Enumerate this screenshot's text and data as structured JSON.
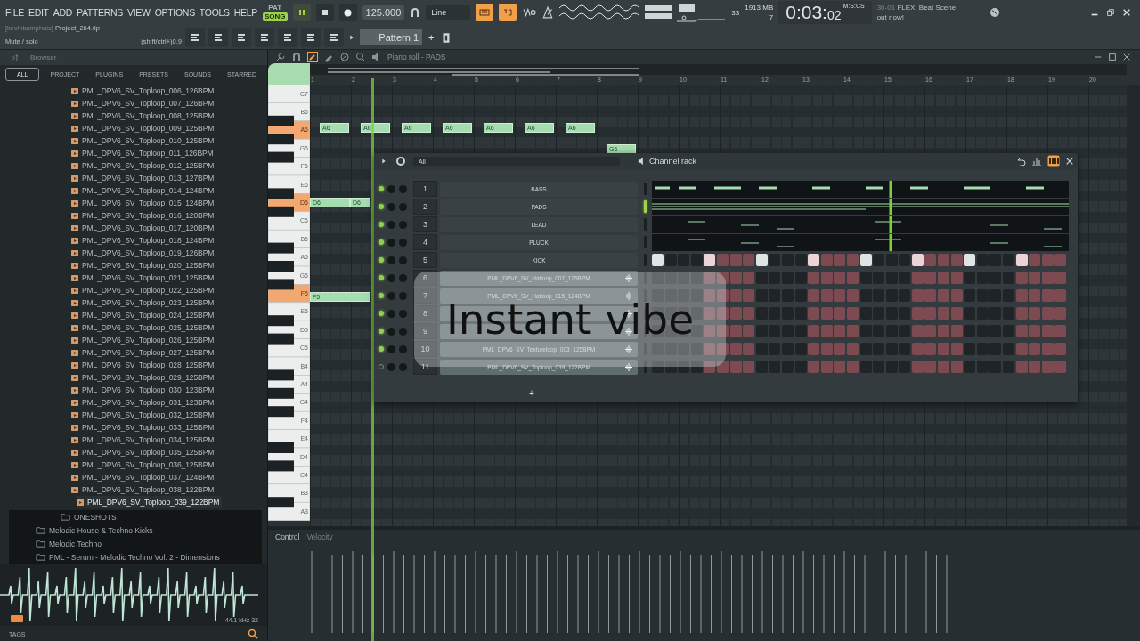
{
  "menu": [
    "FILE",
    "EDIT",
    "ADD",
    "PATTERNS",
    "VIEW",
    "OPTIONS",
    "TOOLS",
    "HELP"
  ],
  "transport": {
    "mode_pat": "PAT",
    "mode_song": "SONG",
    "song_selected": true,
    "playing": true,
    "tempo": "125.000",
    "snap": "Line"
  },
  "monitor": {
    "cpu": "33",
    "memory": "1913 MB",
    "polyphony": "7"
  },
  "time": {
    "value": "0:03:",
    "cs": "02",
    "format": "M:S:CS"
  },
  "news": {
    "date": "30-01",
    "title": "FLEX: Beat Scene",
    "subtitle": "out now!"
  },
  "project": {
    "user": "[kevinkamphuis]",
    "file": "Project_264.flp",
    "hint": "Mute / solo",
    "shortcut": "(shift/ctrl+)0.9"
  },
  "pattern": {
    "name": "Pattern 1",
    "add": "+"
  },
  "browser": {
    "title": "Browser",
    "tabs": [
      {
        "label": "ALL",
        "selected": true
      },
      {
        "label": "PROJECT",
        "selected": false
      },
      {
        "label": "PLUGINS",
        "selected": false
      },
      {
        "label": "PRESETS",
        "selected": false
      },
      {
        "label": "SOUNDS",
        "selected": false
      },
      {
        "label": "STARRED",
        "selected": false
      }
    ],
    "files": [
      {
        "name": "PML_DPV6_SV_Toploop_006_126BPM",
        "selected": false
      },
      {
        "name": "PML_DPV6_SV_Toploop_007_126BPM",
        "selected": false
      },
      {
        "name": "PML_DPV6_SV_Toploop_008_125BPM",
        "selected": false
      },
      {
        "name": "PML_DPV6_SV_Toploop_009_125BPM",
        "selected": false
      },
      {
        "name": "PML_DPV6_SV_Toploop_010_125BPM",
        "selected": false
      },
      {
        "name": "PML_DPV6_SV_Toploop_011_126BPM",
        "selected": false
      },
      {
        "name": "PML_DPV6_SV_Toploop_012_125BPM",
        "selected": false
      },
      {
        "name": "PML_DPV6_SV_Toploop_013_127BPM",
        "selected": false
      },
      {
        "name": "PML_DPV6_SV_Toploop_014_124BPM",
        "selected": false
      },
      {
        "name": "PML_DPV6_SV_Toploop_015_124BPM",
        "selected": false
      },
      {
        "name": "PML_DPV6_SV_Toploop_016_120BPM",
        "selected": false
      },
      {
        "name": "PML_DPV6_SV_Toploop_017_120BPM",
        "selected": false
      },
      {
        "name": "PML_DPV6_SV_Toploop_018_124BPM",
        "selected": false
      },
      {
        "name": "PML_DPV6_SV_Toploop_019_126BPM",
        "selected": false
      },
      {
        "name": "PML_DPV6_SV_Toploop_020_125BPM",
        "selected": false
      },
      {
        "name": "PML_DPV6_SV_Toploop_021_125BPM",
        "selected": false
      },
      {
        "name": "PML_DPV6_SV_Toploop_022_125BPM",
        "selected": false
      },
      {
        "name": "PML_DPV6_SV_Toploop_023_125BPM",
        "selected": false
      },
      {
        "name": "PML_DPV6_SV_Toploop_024_125BPM",
        "selected": false
      },
      {
        "name": "PML_DPV6_SV_Toploop_025_125BPM",
        "selected": false
      },
      {
        "name": "PML_DPV6_SV_Toploop_026_125BPM",
        "selected": false
      },
      {
        "name": "PML_DPV6_SV_Toploop_027_125BPM",
        "selected": false
      },
      {
        "name": "PML_DPV6_SV_Toploop_028_125BPM",
        "selected": false
      },
      {
        "name": "PML_DPV6_SV_Toploop_029_125BPM",
        "selected": false
      },
      {
        "name": "PML_DPV6_SV_Toploop_030_123BPM",
        "selected": false
      },
      {
        "name": "PML_DPV6_SV_Toploop_031_123BPM",
        "selected": false
      },
      {
        "name": "PML_DPV6_SV_Toploop_032_125BPM",
        "selected": false
      },
      {
        "name": "PML_DPV6_SV_Toploop_033_125BPM",
        "selected": false
      },
      {
        "name": "PML_DPV6_SV_Toploop_034_125BPM",
        "selected": false
      },
      {
        "name": "PML_DPV6_SV_Toploop_035_125BPM",
        "selected": false
      },
      {
        "name": "PML_DPV6_SV_Toploop_036_125BPM",
        "selected": false
      },
      {
        "name": "PML_DPV6_SV_Toploop_037_124BPM",
        "selected": false
      },
      {
        "name": "PML_DPV6_SV_Toploop_038_122BPM",
        "selected": false
      },
      {
        "name": "PML_DPV6_SV_Toploop_039_122BPM",
        "selected": true
      }
    ],
    "subfolders": [
      {
        "name": "ONESHOTS"
      }
    ],
    "folders": [
      {
        "name": "Melodic House & Techno Kicks"
      },
      {
        "name": "Melodic Techno"
      },
      {
        "name": "PML - Serum - Melodic Techno Vol. 2 - Dimensions"
      }
    ],
    "preview": {
      "info": "44.1 kHz 32"
    },
    "tags": "TAGS"
  },
  "piano_roll": {
    "title": "Piano roll - PADS",
    "bars": [
      "1",
      "2",
      "3",
      "4",
      "5",
      "6",
      "7",
      "8",
      "9",
      "10",
      "11",
      "12",
      "13",
      "14",
      "15",
      "16",
      "17",
      "18",
      "19",
      "20"
    ],
    "keys": [
      {
        "label": "C7",
        "highlighted": false
      },
      {
        "label": "B6",
        "highlighted": false
      },
      {
        "label": "A6",
        "highlighted": true
      },
      {
        "label": "G6",
        "highlighted": false
      },
      {
        "label": "F6",
        "highlighted": false
      },
      {
        "label": "E6",
        "highlighted": false
      },
      {
        "label": "D6",
        "highlighted": true
      },
      {
        "label": "C6",
        "highlighted": false
      },
      {
        "label": "B5",
        "highlighted": false
      },
      {
        "label": "A5",
        "highlighted": false
      },
      {
        "label": "G5",
        "highlighted": false
      },
      {
        "label": "F5",
        "highlighted": true
      },
      {
        "label": "E5",
        "highlighted": false
      },
      {
        "label": "D5",
        "highlighted": false
      },
      {
        "label": "C5",
        "highlighted": false
      },
      {
        "label": "B4",
        "highlighted": false
      },
      {
        "label": "A4",
        "highlighted": false
      },
      {
        "label": "G4",
        "highlighted": false
      },
      {
        "label": "F4",
        "highlighted": false
      },
      {
        "label": "E4",
        "highlighted": false
      },
      {
        "label": "D4",
        "highlighted": false
      },
      {
        "label": "C4",
        "highlighted": false
      },
      {
        "label": "B3",
        "highlighted": false
      },
      {
        "label": "A3",
        "highlighted": false
      }
    ],
    "notes": [
      {
        "label": "A6"
      },
      {
        "label": "A6"
      },
      {
        "label": "A6"
      },
      {
        "label": "A6"
      },
      {
        "label": "A6"
      },
      {
        "label": "A6"
      },
      {
        "label": "A6"
      },
      {
        "label": "G6"
      },
      {
        "label": "D6"
      },
      {
        "label": "D6"
      },
      {
        "label": "F5"
      }
    ],
    "control": "Control",
    "velocity": "Velocity"
  },
  "channel_rack": {
    "filter": "All",
    "title": "Channel rack",
    "add": "+",
    "channels": [
      {
        "number": "1",
        "name": "BASS",
        "kind": "roll",
        "enabled": true,
        "selected": false
      },
      {
        "number": "2",
        "name": "PADS",
        "kind": "roll",
        "enabled": true,
        "selected": true
      },
      {
        "number": "3",
        "name": "LEAD",
        "kind": "roll",
        "enabled": true,
        "selected": false
      },
      {
        "number": "4",
        "name": "PLUCK",
        "kind": "roll",
        "enabled": true,
        "selected": false
      },
      {
        "number": "5",
        "name": "KICK",
        "kind": "steps",
        "enabled": true,
        "selected": false,
        "steps": [
          true,
          false,
          false,
          false,
          true,
          false,
          false,
          false,
          true,
          false,
          false,
          false,
          true,
          false,
          false,
          false,
          true,
          false,
          false,
          false,
          true,
          false,
          false,
          false,
          true,
          false,
          false,
          false,
          true,
          false,
          false,
          false
        ]
      },
      {
        "number": "6",
        "name": "PML_DPV6_SV_Hatloop_007_125BPM",
        "kind": "sample",
        "enabled": true,
        "selected": false,
        "steps": [
          false,
          false,
          false,
          false,
          false,
          false,
          false,
          false,
          false,
          false,
          false,
          false,
          false,
          false,
          false,
          false,
          false,
          false,
          false,
          false,
          false,
          false,
          false,
          false,
          false,
          false,
          false,
          false,
          false,
          false,
          false,
          false
        ]
      },
      {
        "number": "7",
        "name": "PML_DPV6_SV_Hatloop_015_124BPM",
        "kind": "sample",
        "enabled": true,
        "selected": false,
        "steps": [
          false,
          false,
          false,
          false,
          false,
          false,
          false,
          false,
          false,
          false,
          false,
          false,
          false,
          false,
          false,
          false,
          false,
          false,
          false,
          false,
          false,
          false,
          false,
          false,
          false,
          false,
          false,
          false,
          false,
          false,
          false,
          false
        ]
      },
      {
        "number": "8",
        "kind": "sample",
        "enabled": true,
        "selected": false,
        "steps": [
          false,
          false,
          false,
          false,
          false,
          false,
          false,
          false,
          false,
          false,
          false,
          false,
          false,
          false,
          false,
          false,
          false,
          false,
          false,
          false,
          false,
          false,
          false,
          false,
          false,
          false,
          false,
          false,
          false,
          false,
          false,
          false
        ]
      },
      {
        "number": "9",
        "kind": "sample",
        "enabled": true,
        "selected": false,
        "steps": [
          false,
          false,
          false,
          false,
          false,
          false,
          false,
          false,
          false,
          false,
          false,
          false,
          false,
          false,
          false,
          false,
          false,
          false,
          false,
          false,
          false,
          false,
          false,
          false,
          false,
          false,
          false,
          false,
          false,
          false,
          false,
          false
        ]
      },
      {
        "number": "10",
        "name": "PML_DPV6_SV_Textureloop_003_125BPM",
        "kind": "sample",
        "enabled": true,
        "selected": false,
        "steps": [
          false,
          false,
          false,
          false,
          false,
          false,
          false,
          false,
          false,
          false,
          false,
          false,
          false,
          false,
          false,
          false,
          false,
          false,
          false,
          false,
          false,
          false,
          false,
          false,
          false,
          false,
          false,
          false,
          false,
          false,
          false,
          false
        ]
      },
      {
        "number": "11",
        "name": "PML_DPV6_SV_Toploop_039_122BPM",
        "kind": "sample",
        "enabled": false,
        "selected": false,
        "steps": [
          false,
          false,
          false,
          false,
          false,
          false,
          false,
          false,
          false,
          false,
          false,
          false,
          false,
          false,
          false,
          false,
          false,
          false,
          false,
          false,
          false,
          false,
          false,
          false,
          false,
          false,
          false,
          false,
          false,
          false,
          false,
          false
        ]
      }
    ]
  },
  "caption": "Instant vibe"
}
